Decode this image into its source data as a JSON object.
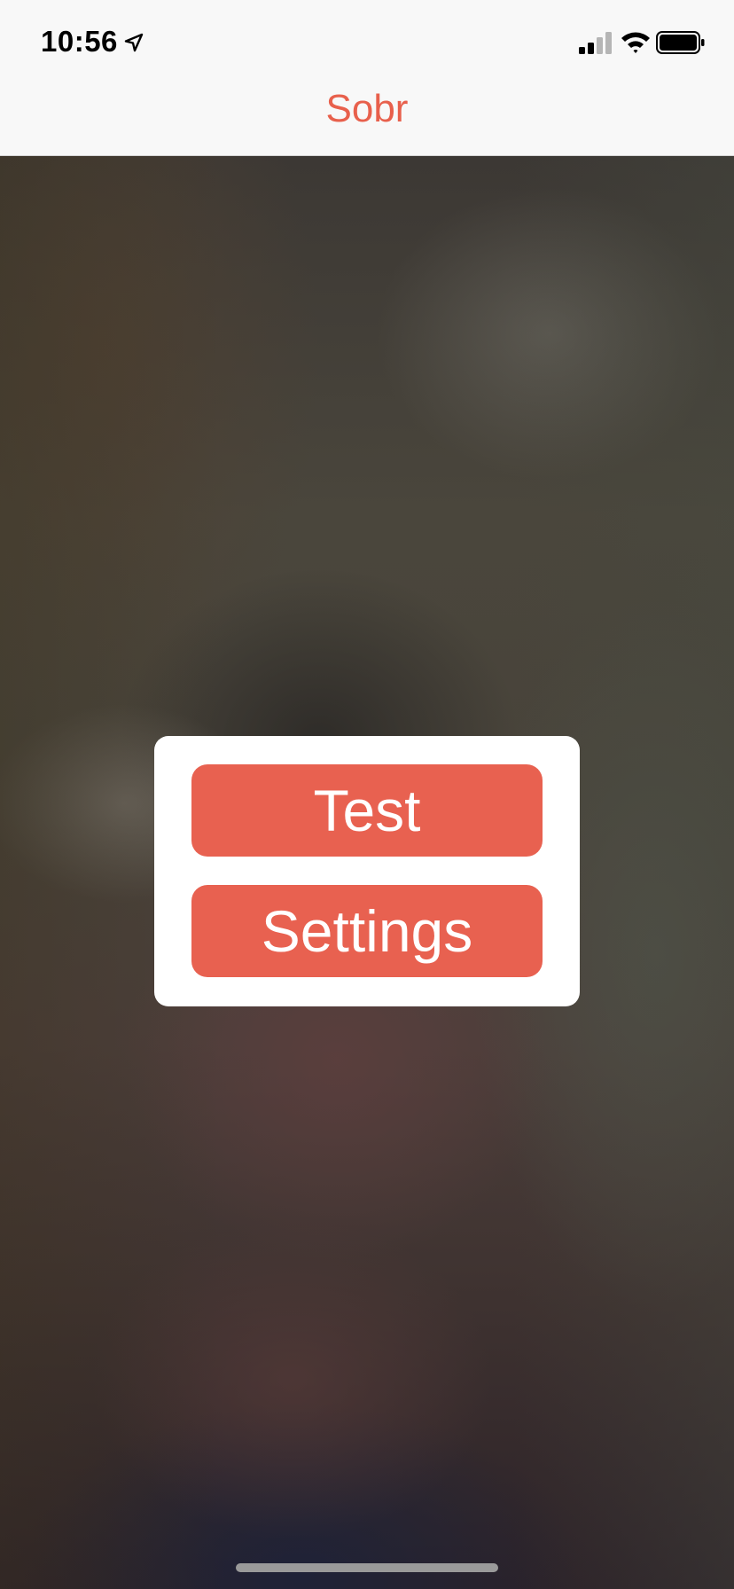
{
  "status_bar": {
    "time": "10:56",
    "icons": [
      "location-arrow-icon",
      "cellular-signal-icon",
      "wifi-icon",
      "battery-icon"
    ]
  },
  "nav": {
    "title": "Sobr"
  },
  "menu": {
    "buttons": [
      {
        "label": "Test"
      },
      {
        "label": "Settings"
      }
    ]
  },
  "colors": {
    "accent": "#e86150",
    "title": "#e8604c",
    "card": "#ffffff",
    "nav_bg": "#f8f8f8"
  }
}
